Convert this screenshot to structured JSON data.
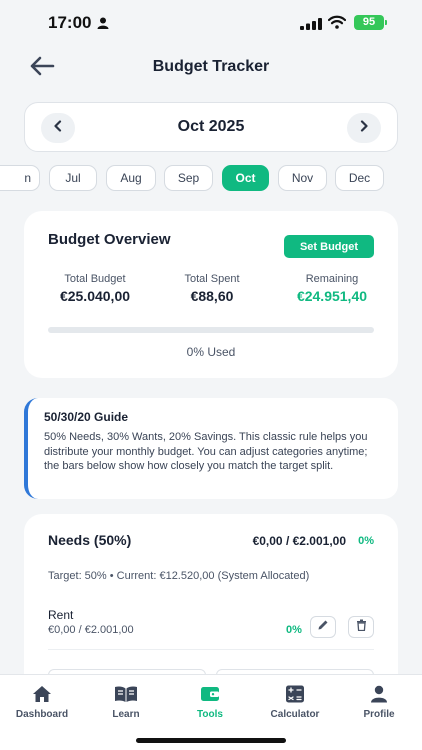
{
  "status": {
    "time": "17:00",
    "battery": "95"
  },
  "header": {
    "title": "Budget Tracker"
  },
  "month_selector": {
    "current": "Oct 2025"
  },
  "months": [
    {
      "label": "n",
      "active": false
    },
    {
      "label": "Jul",
      "active": false
    },
    {
      "label": "Aug",
      "active": false
    },
    {
      "label": "Sep",
      "active": false
    },
    {
      "label": "Oct",
      "active": true
    },
    {
      "label": "Nov",
      "active": false
    },
    {
      "label": "Dec",
      "active": false
    }
  ],
  "overview": {
    "title": "Budget Overview",
    "set_budget_label": "Set Budget",
    "total_budget_label": "Total Budget",
    "total_budget_value": "€25.040,00",
    "total_spent_label": "Total Spent",
    "total_spent_value": "€88,60",
    "remaining_label": "Remaining",
    "remaining_value": "€24.951,40",
    "used_fraction": 0,
    "used_label": "0% Used"
  },
  "guide": {
    "title": "50/30/20 Guide",
    "body": "50% Needs, 30% Wants, 20% Savings. This classic rule helps you distribute your monthly budget. You can adjust categories anytime; the bars below show how closely you match the target split."
  },
  "needs": {
    "title": "Needs (50%)",
    "amount": "€0,00 / €2.001,00",
    "percent": "0%",
    "target": "Target: 50% • Current: €12.520,00 (System Allocated)",
    "items": [
      {
        "name": "Rent",
        "amount": "€0,00 / €2.001,00",
        "percent": "0%"
      }
    ]
  },
  "tabbar": {
    "tabs": [
      {
        "label": "Dashboard",
        "icon": "home-icon",
        "active": false
      },
      {
        "label": "Learn",
        "icon": "book-icon",
        "active": false
      },
      {
        "label": "Tools",
        "icon": "wallet-icon",
        "active": true
      },
      {
        "label": "Calculator",
        "icon": "calculator-icon",
        "active": false
      },
      {
        "label": "Profile",
        "icon": "person-icon",
        "active": false
      }
    ]
  },
  "colors": {
    "accent": "#10b981",
    "guide_border": "#2f78d8",
    "text": "#1a2233"
  }
}
